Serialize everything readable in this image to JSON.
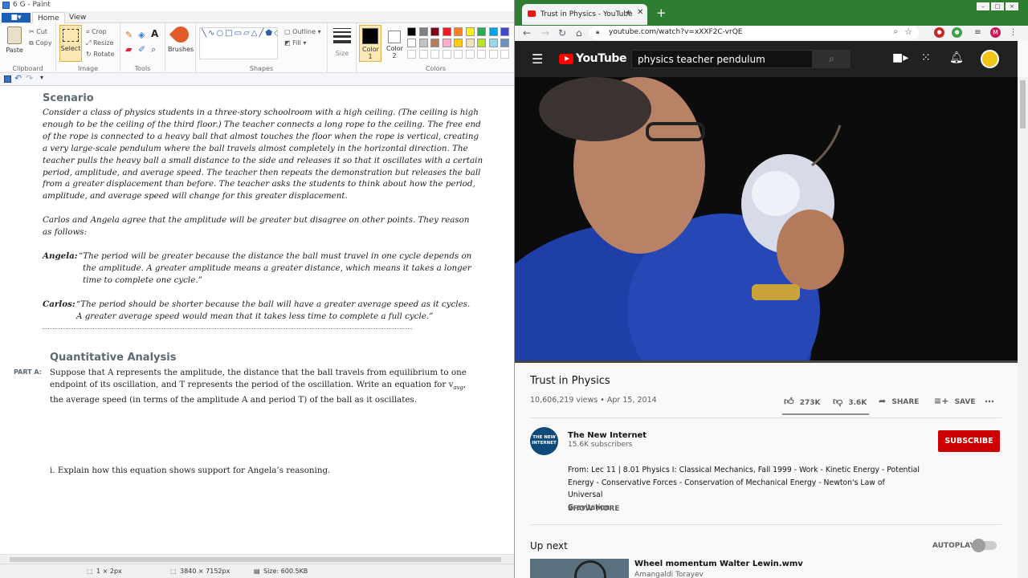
{
  "paint": {
    "window_title": "6 G - Paint",
    "file_tab": "■▾",
    "tabs": [
      "Home",
      "View"
    ],
    "clipboard": {
      "paste": "Paste",
      "cut": "Cut",
      "copy": "Copy",
      "group": "Clipboard"
    },
    "image": {
      "select": "Select",
      "crop": "Crop",
      "resize": "Resize",
      "rotate": "Rotate",
      "group": "Image"
    },
    "tools_group": "Tools",
    "brushes": "Brushes",
    "shapes": {
      "outline": "Outline",
      "fill": "Fill",
      "group": "Shapes"
    },
    "size": "Size",
    "color1": "Color 1",
    "color2": "Color 2",
    "colors_group": "Colors",
    "palette": [
      "#000000",
      "#7f7f7f",
      "#880015",
      "#ed1c24",
      "#ff7f27",
      "#fff200",
      "#22b14c",
      "#00a2e8",
      "#3f48cc",
      "#ffffff",
      "#c3c3c3",
      "#b97a57",
      "#ffaec9",
      "#ffc90e",
      "#efe4b0",
      "#b5e61d",
      "#99d9ea",
      "#7092be"
    ],
    "status": {
      "size_px": "1 × 2px",
      "dimensions": "3840 × 7152px",
      "filesize": "Size: 600.5KB"
    }
  },
  "document": {
    "scenario_heading": "Scenario",
    "scenario_lines": [
      "Consider a class of physics students in a three-story schoolroom with a high ceiling. (The ceiling is high",
      "enough to be the ceiling of the third floor.) The teacher connects a long rope to the ceiling. The free end",
      "of the rope is connected to a heavy ball that almost touches the floor when the rope is vertical, creating",
      "a very large-scale pendulum where the ball travels almost completely in the horizontal direction. The",
      "teacher pulls the heavy ball a small distance to the side and releases it so that it oscillates with a certain",
      "period, amplitude, and average speed. The teacher then repeats the demonstration but releases the ball",
      "from a greater displacement than before. The teacher asks the students to think about how the period,",
      "amplitude, and average speed will change for this greater displacement."
    ],
    "carlos_angela_lines": [
      "Carlos and Angela agree that the amplitude will be greater but disagree on other points. They reason",
      "as follows:"
    ],
    "angela_label": "Angela:",
    "angela_lines": [
      "“The period will be greater because the distance the ball must travel in one cycle depends on",
      "the amplitude. A greater amplitude means a greater distance, which means it takes a longer",
      "time to complete one cycle.”"
    ],
    "carlos_label": "Carlos:",
    "carlos_lines": [
      "“The period should be shorter because the ball will have a greater average speed as it cycles.",
      "A greater average speed would mean that it takes less time to complete a full cycle.”"
    ],
    "quant_heading": "Quantitative Analysis",
    "part_a_label": "PART A:",
    "part_a_lines": [
      "Suppose that A represents the amplitude, the distance that the ball travels from equilibrium to one",
      "endpoint of its oscillation, and T represents the period of the oscillation. Write an equation for v",
      "the average speed (in terms of the amplitude A and period T) of the ball as it oscillates."
    ],
    "v_subscript": "avg",
    "question_1": "i.  Explain how this equation shows support for Angela’s reasoning."
  },
  "browser": {
    "tab_title": "Trust in Physics - YouTube",
    "url": "youtube.com/watch?v=xXXF2C-vrQE",
    "profile_initial": "M",
    "window_controls": [
      "–",
      "□",
      "×"
    ]
  },
  "youtube": {
    "logo_text": "YouTube",
    "search_query": "physics teacher pendulum",
    "video_title": "Trust in Physics",
    "views": "10,606,219 views",
    "date": "Apr 15, 2014",
    "likes": "273K",
    "dislikes": "3.6K",
    "share": "SHARE",
    "save": "SAVE",
    "channel_name": "The New Internet",
    "channel_logo_text": "THE NEW INTERNET",
    "subscribers": "15.6K subscribers",
    "subscribe": "SUBSCRIBE",
    "description_lines": [
      "From: Lec 11 | 8.01 Physics I: Classical Mechanics, Fall 1999 - Work - Kinetic Energy - Potential",
      "Energy - Conservative Forces - Conservation of Mechanical Energy - Newton's Law of Universal",
      "Gravitation"
    ],
    "show_more": "SHOW MORE",
    "up_next": "Up next",
    "autoplay": "AUTOPLAY",
    "next_title": "Wheel momentum Walter Lewin.wmv",
    "next_channel": "Amangaldi Torayev"
  }
}
